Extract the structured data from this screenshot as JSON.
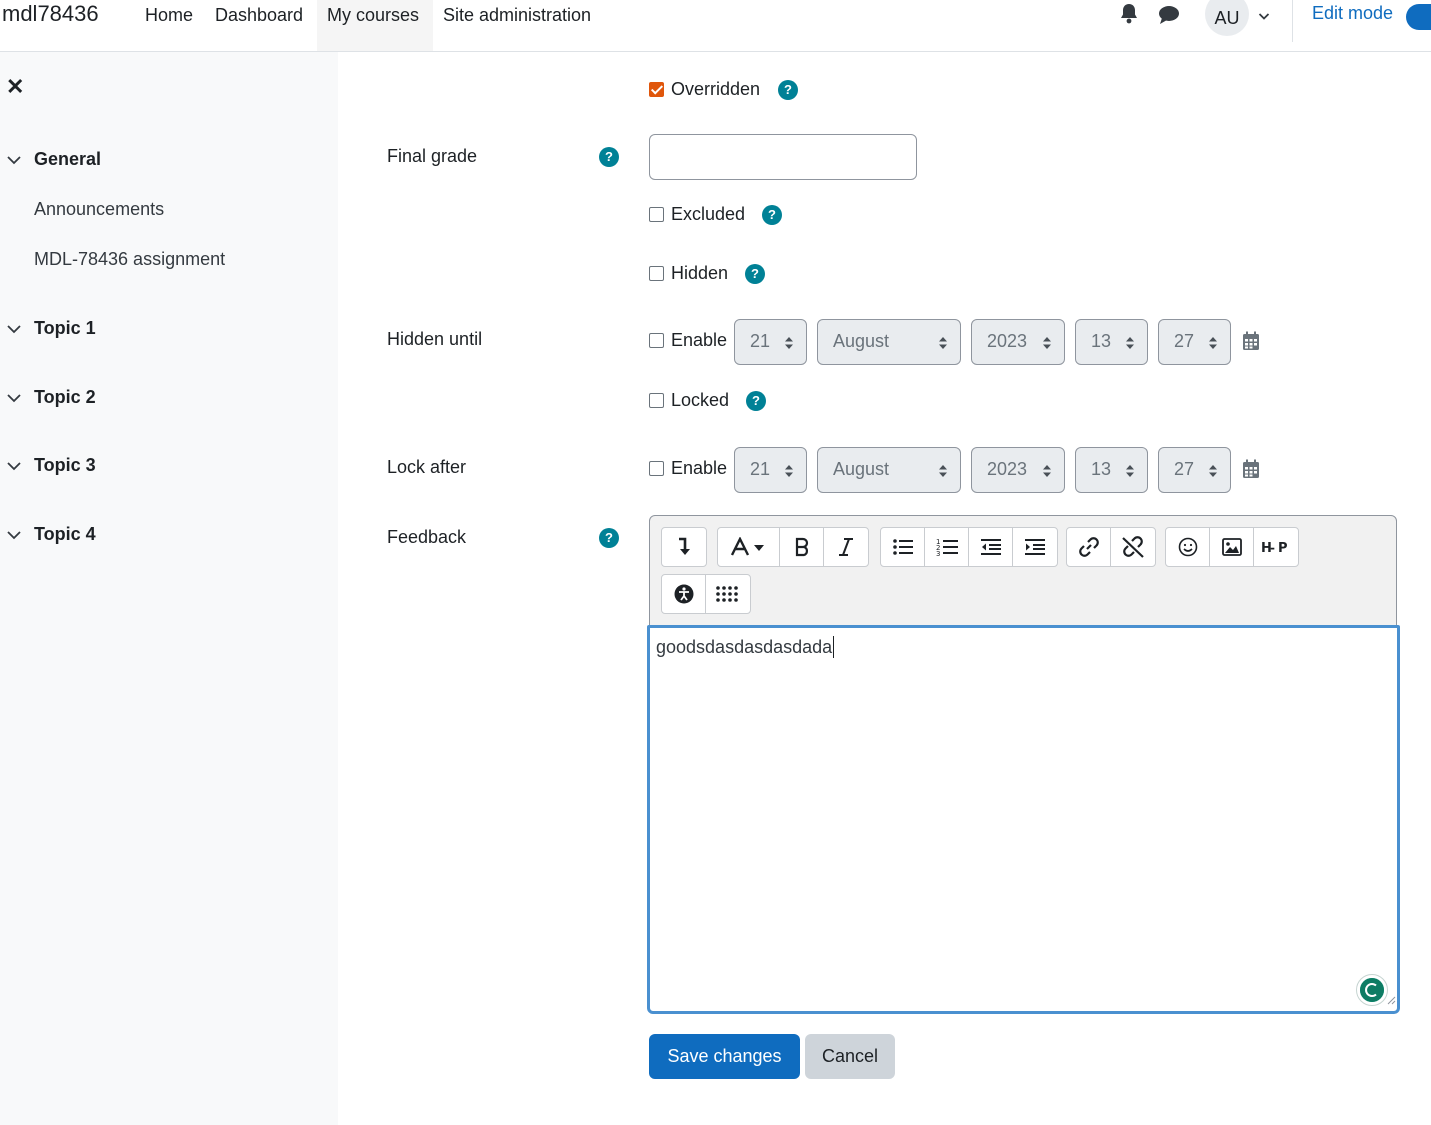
{
  "navbar": {
    "site_name": "mdl78436",
    "links": [
      "Home",
      "Dashboard",
      "My courses",
      "Site administration"
    ],
    "avatar_initials": "AU",
    "edit_mode_label": "Edit mode"
  },
  "sidebar": {
    "sections": [
      {
        "title": "General",
        "items": [
          "Announcements",
          "MDL-78436 assignment"
        ]
      },
      {
        "title": "Topic 1",
        "items": []
      },
      {
        "title": "Topic 2",
        "items": []
      },
      {
        "title": "Topic 3",
        "items": []
      },
      {
        "title": "Topic 4",
        "items": []
      }
    ]
  },
  "form": {
    "overridden_label": "Overridden",
    "overridden_checked": true,
    "final_grade_label": "Final grade",
    "final_grade_value": "",
    "excluded_label": "Excluded",
    "hidden_label": "Hidden",
    "hidden_until_label": "Hidden until",
    "locked_label": "Locked",
    "lock_after_label": "Lock after",
    "enable_label": "Enable",
    "hidden_until": {
      "day": "21",
      "month": "August",
      "year": "2023",
      "hour": "13",
      "minute": "27"
    },
    "lock_after": {
      "day": "21",
      "month": "August",
      "year": "2023",
      "hour": "13",
      "minute": "27"
    },
    "feedback_label": "Feedback",
    "feedback_text": "goodsdasdasdasdada",
    "help_symbol": "?"
  },
  "buttons": {
    "save": "Save changes",
    "cancel": "Cancel"
  },
  "colors": {
    "primary": "#0f6cbf",
    "help": "#008196",
    "checked": "#e0560b"
  }
}
